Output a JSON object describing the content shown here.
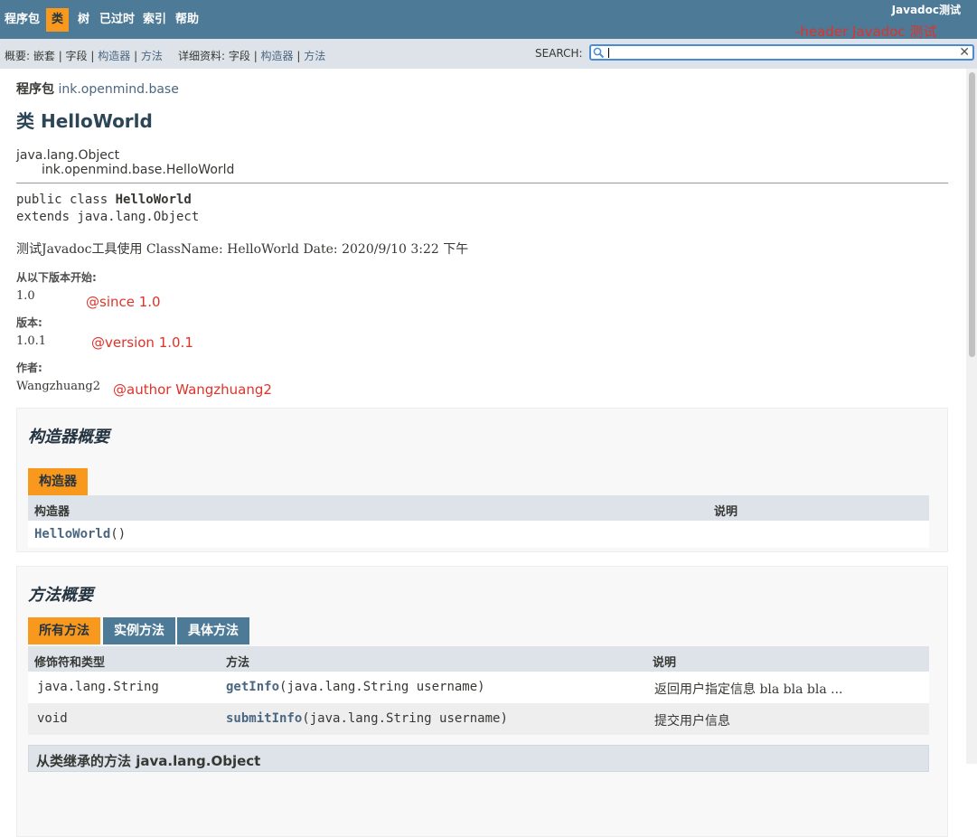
{
  "topnav": {
    "items": [
      "程序包",
      "类",
      "树",
      "已过时",
      "索引",
      "帮助"
    ],
    "about": "Javadoc测试"
  },
  "annotations": {
    "header": "-header Javadoc 测试",
    "since": "@since 1.0",
    "version": "@version 1.0.1",
    "author": "@author Wangzhuang2"
  },
  "subnav": {
    "summary_label": "概要: ",
    "summary_nested": "嵌套",
    "summary_field": "字段",
    "summary_constr": "构造器",
    "summary_method": "方法",
    "detail_label": "详细资料: ",
    "detail_field": "字段",
    "detail_constr": "构造器",
    "detail_method": "方法",
    "sep": " | "
  },
  "search": {
    "label": "SEARCH:",
    "value": ""
  },
  "page": {
    "pkg_label": "程序包",
    "pkg_name": "ink.openmind.base",
    "class_title": "类 HelloWorld",
    "inherit_root": "java.lang.Object",
    "inherit_child": "ink.openmind.base.HelloWorld",
    "decl_prefix": "public class ",
    "decl_name": "HelloWorld",
    "decl_extends": "extends java.lang.Object",
    "description": "测试Javadoc工具使用 ClassName: HelloWorld Date: 2020/9/10 3:22 下午",
    "since_label": "从以下版本开始:",
    "since_value": "1.0",
    "version_label": "版本:",
    "version_value": "1.0.1",
    "author_label": "作者:",
    "author_value": "Wangzhuang2"
  },
  "constructor_summary": {
    "title": "构造器概要",
    "tab": "构造器",
    "col1": "构造器",
    "col2": "说明",
    "rows": [
      {
        "name": "HelloWorld",
        "params": "()"
      }
    ]
  },
  "method_summary": {
    "title": "方法概要",
    "tabs": [
      "所有方法",
      "实例方法",
      "具体方法"
    ],
    "cols": [
      "修饰符和类型",
      "方法",
      "说明"
    ],
    "rows": [
      {
        "type": "java.lang.String",
        "name": "getInfo",
        "params": "(java.lang.String username)",
        "desc": "返回用户指定信息 bla bla bla ..."
      },
      {
        "type": "void",
        "name": "submitInfo",
        "params": "(java.lang.String username)",
        "desc": "提交用户信息"
      }
    ],
    "inherited": "从类继承的方法 java.lang.Object"
  },
  "colors": {
    "nav": "#4D7A97",
    "active": "#F8981D",
    "subnav": "#DEE3E9",
    "annot": "#E0322A"
  }
}
